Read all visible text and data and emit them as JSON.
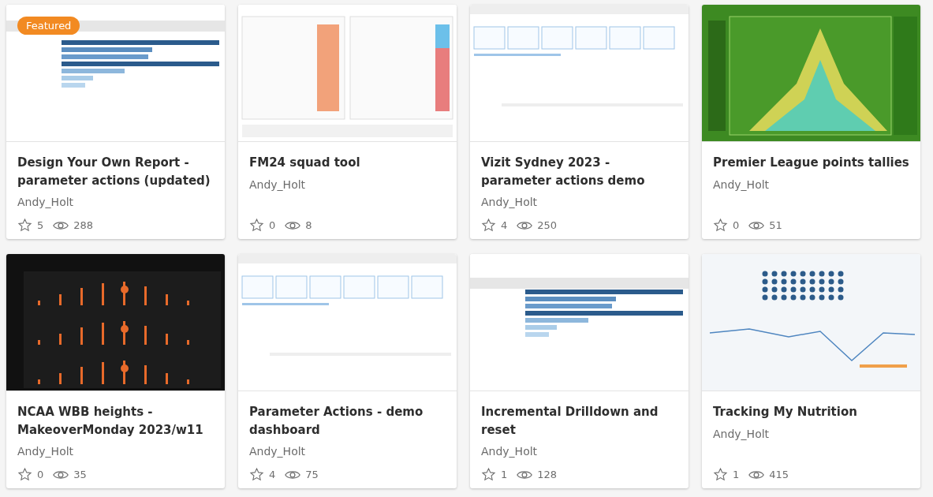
{
  "cards": [
    {
      "badge": "Featured",
      "title": "Design Your Own Report - parameter actions (updated)",
      "author": "Andy_Holt",
      "favorites": "5",
      "views": "288"
    },
    {
      "title": "FM24 squad tool",
      "author": "Andy_Holt",
      "favorites": "0",
      "views": "8"
    },
    {
      "title": "Vizit Sydney 2023 - parameter actions demo",
      "author": "Andy_Holt",
      "favorites": "4",
      "views": "250"
    },
    {
      "title": "Premier League points tallies",
      "author": "Andy_Holt",
      "favorites": "0",
      "views": "51"
    },
    {
      "title": "NCAA WBB heights - MakeoverMonday 2023/w11",
      "author": "Andy_Holt",
      "favorites": "0",
      "views": "35"
    },
    {
      "title": "Parameter Actions - demo dashboard",
      "author": "Andy_Holt",
      "favorites": "4",
      "views": "75"
    },
    {
      "title": "Incremental Drilldown and reset",
      "author": "Andy_Holt",
      "favorites": "1",
      "views": "128"
    },
    {
      "title": "Tracking My Nutrition",
      "author": "Andy_Holt",
      "favorites": "1",
      "views": "415"
    }
  ]
}
